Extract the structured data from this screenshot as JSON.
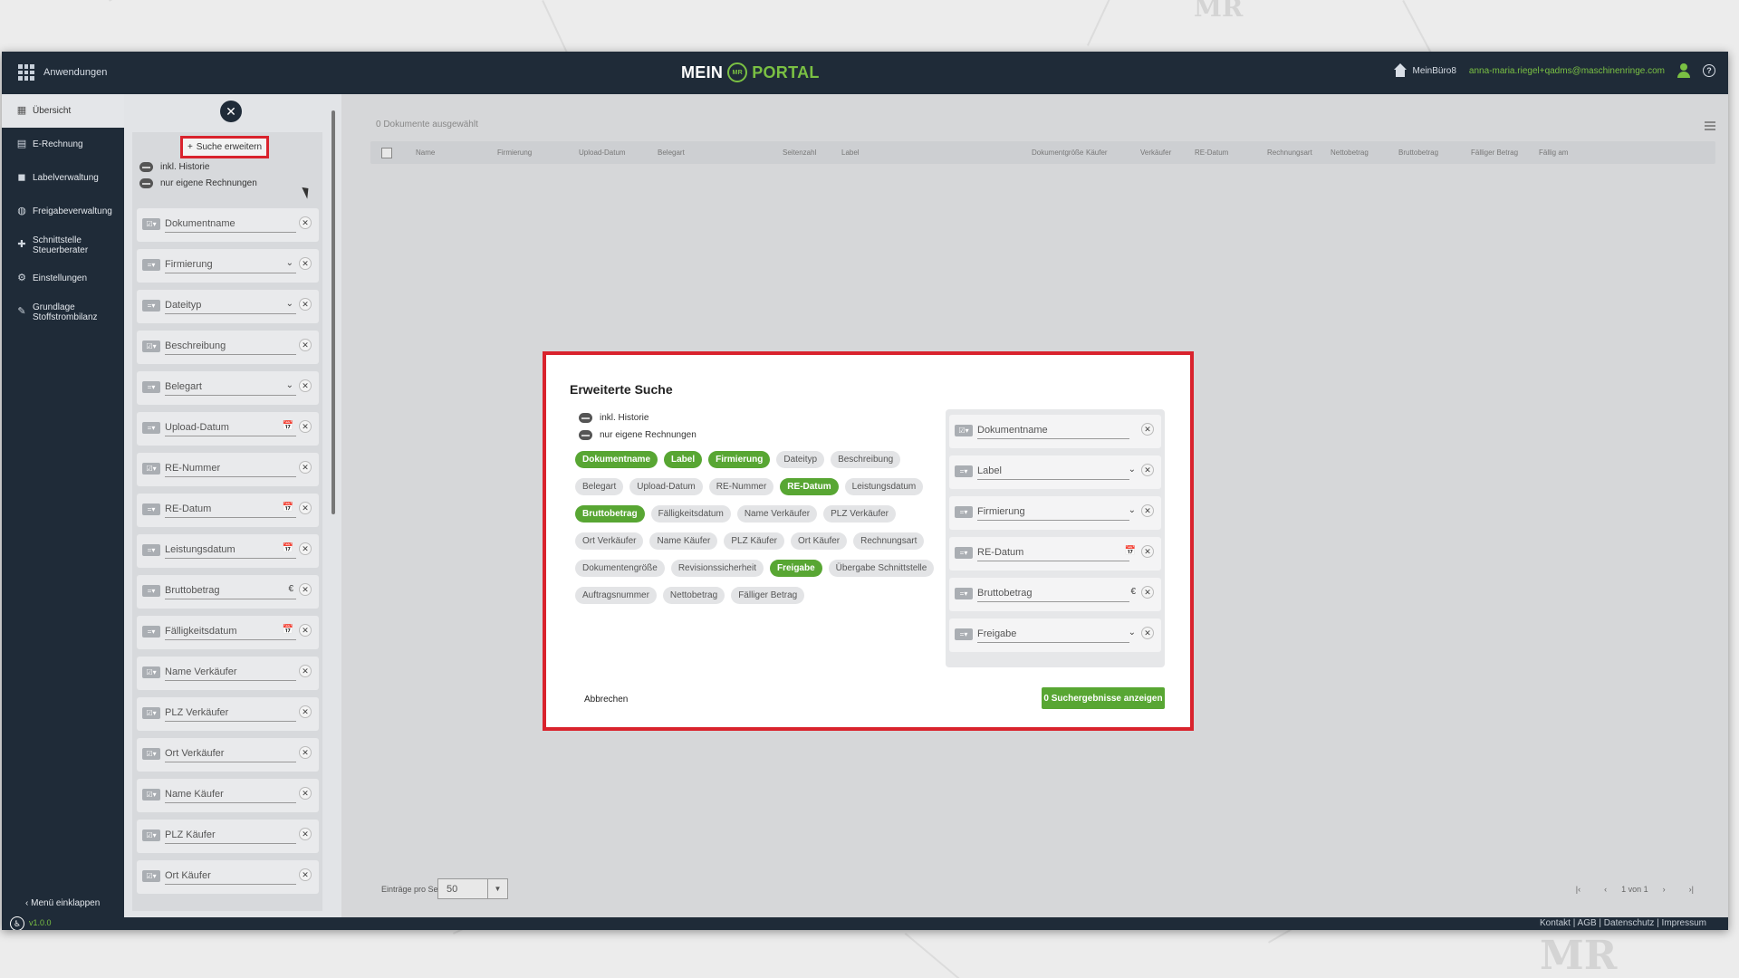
{
  "topbar": {
    "apps_label": "Anwendungen",
    "logo_left": "MEIN",
    "logo_badge": "MR",
    "logo_right": "PORTAL",
    "buero": "MeinBüro8",
    "email": "anna-maria.riegel+qadms@maschinenringe.com",
    "help": "?"
  },
  "sidebar": {
    "items": [
      {
        "label": "Übersicht",
        "icon": "grid-icon"
      },
      {
        "label": "E-Rechnung",
        "icon": "document-icon"
      },
      {
        "label": "Labelverwaltung",
        "icon": "label-icon"
      },
      {
        "label": "Freigabeverwaltung",
        "icon": "globe-icon"
      },
      {
        "label": "Schnittstelle Steuerberater",
        "icon": "puzzle-icon"
      },
      {
        "label": "Einstellungen",
        "icon": "gear-icon"
      },
      {
        "label": "Grundlage Stoffstrombilanz",
        "icon": "tools-icon"
      }
    ],
    "collapse_label": "Menü einklappen"
  },
  "panel": {
    "close": "✕",
    "extend_search": "Suche erweitern",
    "toggle_history": "inkl. Historie",
    "toggle_own": "nur eigene Rechnungen",
    "filters": [
      {
        "label": "Dokumentname",
        "op": "☑▾",
        "extra": ""
      },
      {
        "label": "Firmierung",
        "op": "=▾",
        "extra": "⌄"
      },
      {
        "label": "Dateityp",
        "op": "=▾",
        "extra": "⌄"
      },
      {
        "label": "Beschreibung",
        "op": "☑▾",
        "extra": ""
      },
      {
        "label": "Belegart",
        "op": "=▾",
        "extra": "⌄"
      },
      {
        "label": "Upload-Datum",
        "op": "=▾",
        "extra": "📅"
      },
      {
        "label": "RE-Nummer",
        "op": "☑▾",
        "extra": ""
      },
      {
        "label": "RE-Datum",
        "op": "=▾",
        "extra": "📅"
      },
      {
        "label": "Leistungsdatum",
        "op": "=▾",
        "extra": "📅"
      },
      {
        "label": "Bruttobetrag",
        "op": "=▾",
        "extra": "€"
      },
      {
        "label": "Fälligkeitsdatum",
        "op": "=▾",
        "extra": "📅"
      },
      {
        "label": "Name Verkäufer",
        "op": "☑▾",
        "extra": ""
      },
      {
        "label": "PLZ Verkäufer",
        "op": "☑▾",
        "extra": ""
      },
      {
        "label": "Ort Verkäufer",
        "op": "☑▾",
        "extra": ""
      },
      {
        "label": "Name Käufer",
        "op": "☑▾",
        "extra": ""
      },
      {
        "label": "PLZ Käufer",
        "op": "☑▾",
        "extra": ""
      },
      {
        "label": "Ort Käufer",
        "op": "☑▾",
        "extra": ""
      }
    ]
  },
  "main": {
    "selected": "0 Dokumente ausgewählt",
    "columns": [
      "Name",
      "Firmierung",
      "Upload-Datum",
      "Belegart",
      "Seitenzahl",
      "Label",
      "Dokumentgröße",
      "Käufer",
      "Verkäufer",
      "RE-Datum",
      "Rechnungsart",
      "Nettobetrag",
      "Bruttobetrag",
      "Fälliger Betrag",
      "Fällig am"
    ],
    "per_page_label": "Einträge pro Seite",
    "per_page": "50",
    "page_info": "1 von 1"
  },
  "dialog": {
    "title": "Erweiterte Suche",
    "toggle_history": "inkl. Historie",
    "toggle_own": "nur eigene Rechnungen",
    "chips": [
      {
        "label": "Dokumentname",
        "on": true
      },
      {
        "label": "Label",
        "on": true
      },
      {
        "label": "Firmierung",
        "on": true
      },
      {
        "label": "Dateityp",
        "on": false
      },
      {
        "label": "Beschreibung",
        "on": false
      },
      {
        "label": "Belegart",
        "on": false
      },
      {
        "label": "Upload-Datum",
        "on": false
      },
      {
        "label": "RE-Nummer",
        "on": false
      },
      {
        "label": "RE-Datum",
        "on": true
      },
      {
        "label": "Leistungsdatum",
        "on": false
      },
      {
        "label": "Bruttobetrag",
        "on": true
      },
      {
        "label": "Fälligkeitsdatum",
        "on": false
      },
      {
        "label": "Name Verkäufer",
        "on": false
      },
      {
        "label": "PLZ Verkäufer",
        "on": false
      },
      {
        "label": "Ort Verkäufer",
        "on": false
      },
      {
        "label": "Name Käufer",
        "on": false
      },
      {
        "label": "PLZ Käufer",
        "on": false
      },
      {
        "label": "Ort Käufer",
        "on": false
      },
      {
        "label": "Rechnungsart",
        "on": false
      },
      {
        "label": "Dokumentengröße",
        "on": false
      },
      {
        "label": "Revisionssicherheit",
        "on": false
      },
      {
        "label": "Freigabe",
        "on": true
      },
      {
        "label": "Übergabe Schnittstelle",
        "on": false
      },
      {
        "label": "Auftragsnummer",
        "on": false
      },
      {
        "label": "Nettobetrag",
        "on": false
      },
      {
        "label": "Fälliger Betrag",
        "on": false
      }
    ],
    "filters": [
      {
        "label": "Dokumentname",
        "op": "☑▾",
        "extra": ""
      },
      {
        "label": "Label",
        "op": "=▾",
        "extra": "⌄"
      },
      {
        "label": "Firmierung",
        "op": "=▾",
        "extra": "⌄"
      },
      {
        "label": "RE-Datum",
        "op": "=▾",
        "extra": "📅"
      },
      {
        "label": "Bruttobetrag",
        "op": "=▾",
        "extra": "€"
      },
      {
        "label": "Freigabe",
        "op": "=▾",
        "extra": "⌄"
      }
    ],
    "cancel": "Abbrechen",
    "submit": "0 Suchergebnisse anzeigen"
  },
  "footer": {
    "links": "Kontakt  |  AGB  |  Datenschutz  |  Impressum",
    "version": "v1.0.0",
    "a11y": "♿"
  },
  "colors": {
    "accent": "#58a633",
    "navy": "#1f2b38",
    "highlight": "#d9232d"
  }
}
